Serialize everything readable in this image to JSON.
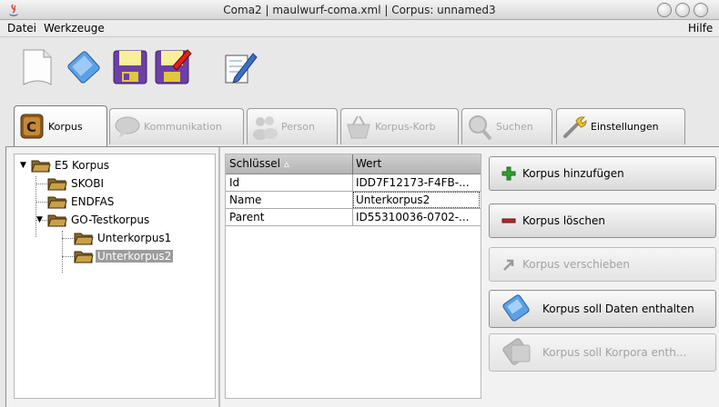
{
  "window": {
    "title": "Coma2 | maulwurf-coma.xml | Corpus: unnamed3"
  },
  "menu": {
    "items": [
      "Datei",
      "Werkzeuge"
    ],
    "help": "Hilfe"
  },
  "toolbar": {
    "icons": [
      "new-document-icon",
      "open-icon",
      "save-icon",
      "save-as-icon",
      "edit-icon"
    ]
  },
  "tabs": [
    {
      "label": "Korpus",
      "icon": "corpus-c-icon",
      "active": true,
      "enabled": true
    },
    {
      "label": "Kommunikation",
      "icon": "speech-bubble-icon",
      "active": false,
      "enabled": false
    },
    {
      "label": "Person",
      "icon": "people-icon",
      "active": false,
      "enabled": false
    },
    {
      "label": "Korpus-Korb",
      "icon": "basket-icon",
      "active": false,
      "enabled": false
    },
    {
      "label": "Suchen",
      "icon": "magnifier-icon",
      "active": false,
      "enabled": false
    },
    {
      "label": "Einstellungen",
      "icon": "wrench-icon",
      "active": false,
      "enabled": true
    }
  ],
  "tree": {
    "nodes": [
      {
        "label": "E5 Korpus",
        "level": 0,
        "expanded": true,
        "selected": false
      },
      {
        "label": "SKOBI",
        "level": 1,
        "expanded": false,
        "selected": false
      },
      {
        "label": "ENDFAS",
        "level": 1,
        "expanded": false,
        "selected": false
      },
      {
        "label": "GO-Testkorpus",
        "level": 1,
        "expanded": true,
        "selected": false
      },
      {
        "label": "Unterkorpus1",
        "level": 2,
        "expanded": false,
        "selected": false
      },
      {
        "label": "Unterkorpus2",
        "level": 2,
        "expanded": false,
        "selected": true
      }
    ]
  },
  "table": {
    "columns": [
      "Schlüssel",
      "Wert"
    ],
    "sort_indicator": "▵",
    "rows": [
      [
        "Id",
        "IDD7F12173-F4FB-..."
      ],
      [
        "Name",
        "Unterkorpus2"
      ],
      [
        "Parent",
        "ID55310036-0702-..."
      ]
    ]
  },
  "actions": [
    {
      "label": "Korpus hinzufügen",
      "icon": "plus-icon",
      "enabled": true
    },
    {
      "label": "Korpus löschen",
      "icon": "minus-icon",
      "enabled": true
    },
    {
      "label": "Korpus verschieben",
      "icon": "arrow-move-icon",
      "enabled": false
    },
    {
      "label": "Korpus soll Daten enthalten",
      "icon": "data-document-icon",
      "enabled": true
    },
    {
      "label": "Korpus soll Korpora enth...",
      "icon": "corpora-icon",
      "enabled": false
    }
  ],
  "colors": {
    "plus": "#2fa12f",
    "minus": "#b02a2a",
    "selection": "#9c9c9c",
    "table_header": "#c4c4c4",
    "folder": "#7a5a1e"
  }
}
